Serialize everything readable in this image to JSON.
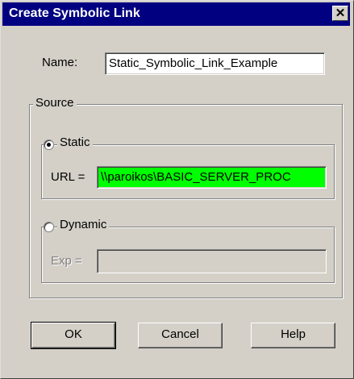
{
  "window": {
    "title": "Create Symbolic Link",
    "close_glyph": "✕"
  },
  "name_field": {
    "label": "Name:",
    "value": "Static_Symbolic_Link_Example"
  },
  "source_group": {
    "legend": "Source"
  },
  "static_option": {
    "label": "Static",
    "selected": true,
    "url_label": "URL =",
    "url_value": "\\\\paroikos\\BASIC_SERVER_PROC",
    "url_bg": "#00ff00"
  },
  "dynamic_option": {
    "label": "Dynamic",
    "selected": false,
    "exp_label": "Exp =",
    "exp_value": ""
  },
  "buttons": {
    "ok": "OK",
    "cancel": "Cancel",
    "help": "Help"
  }
}
